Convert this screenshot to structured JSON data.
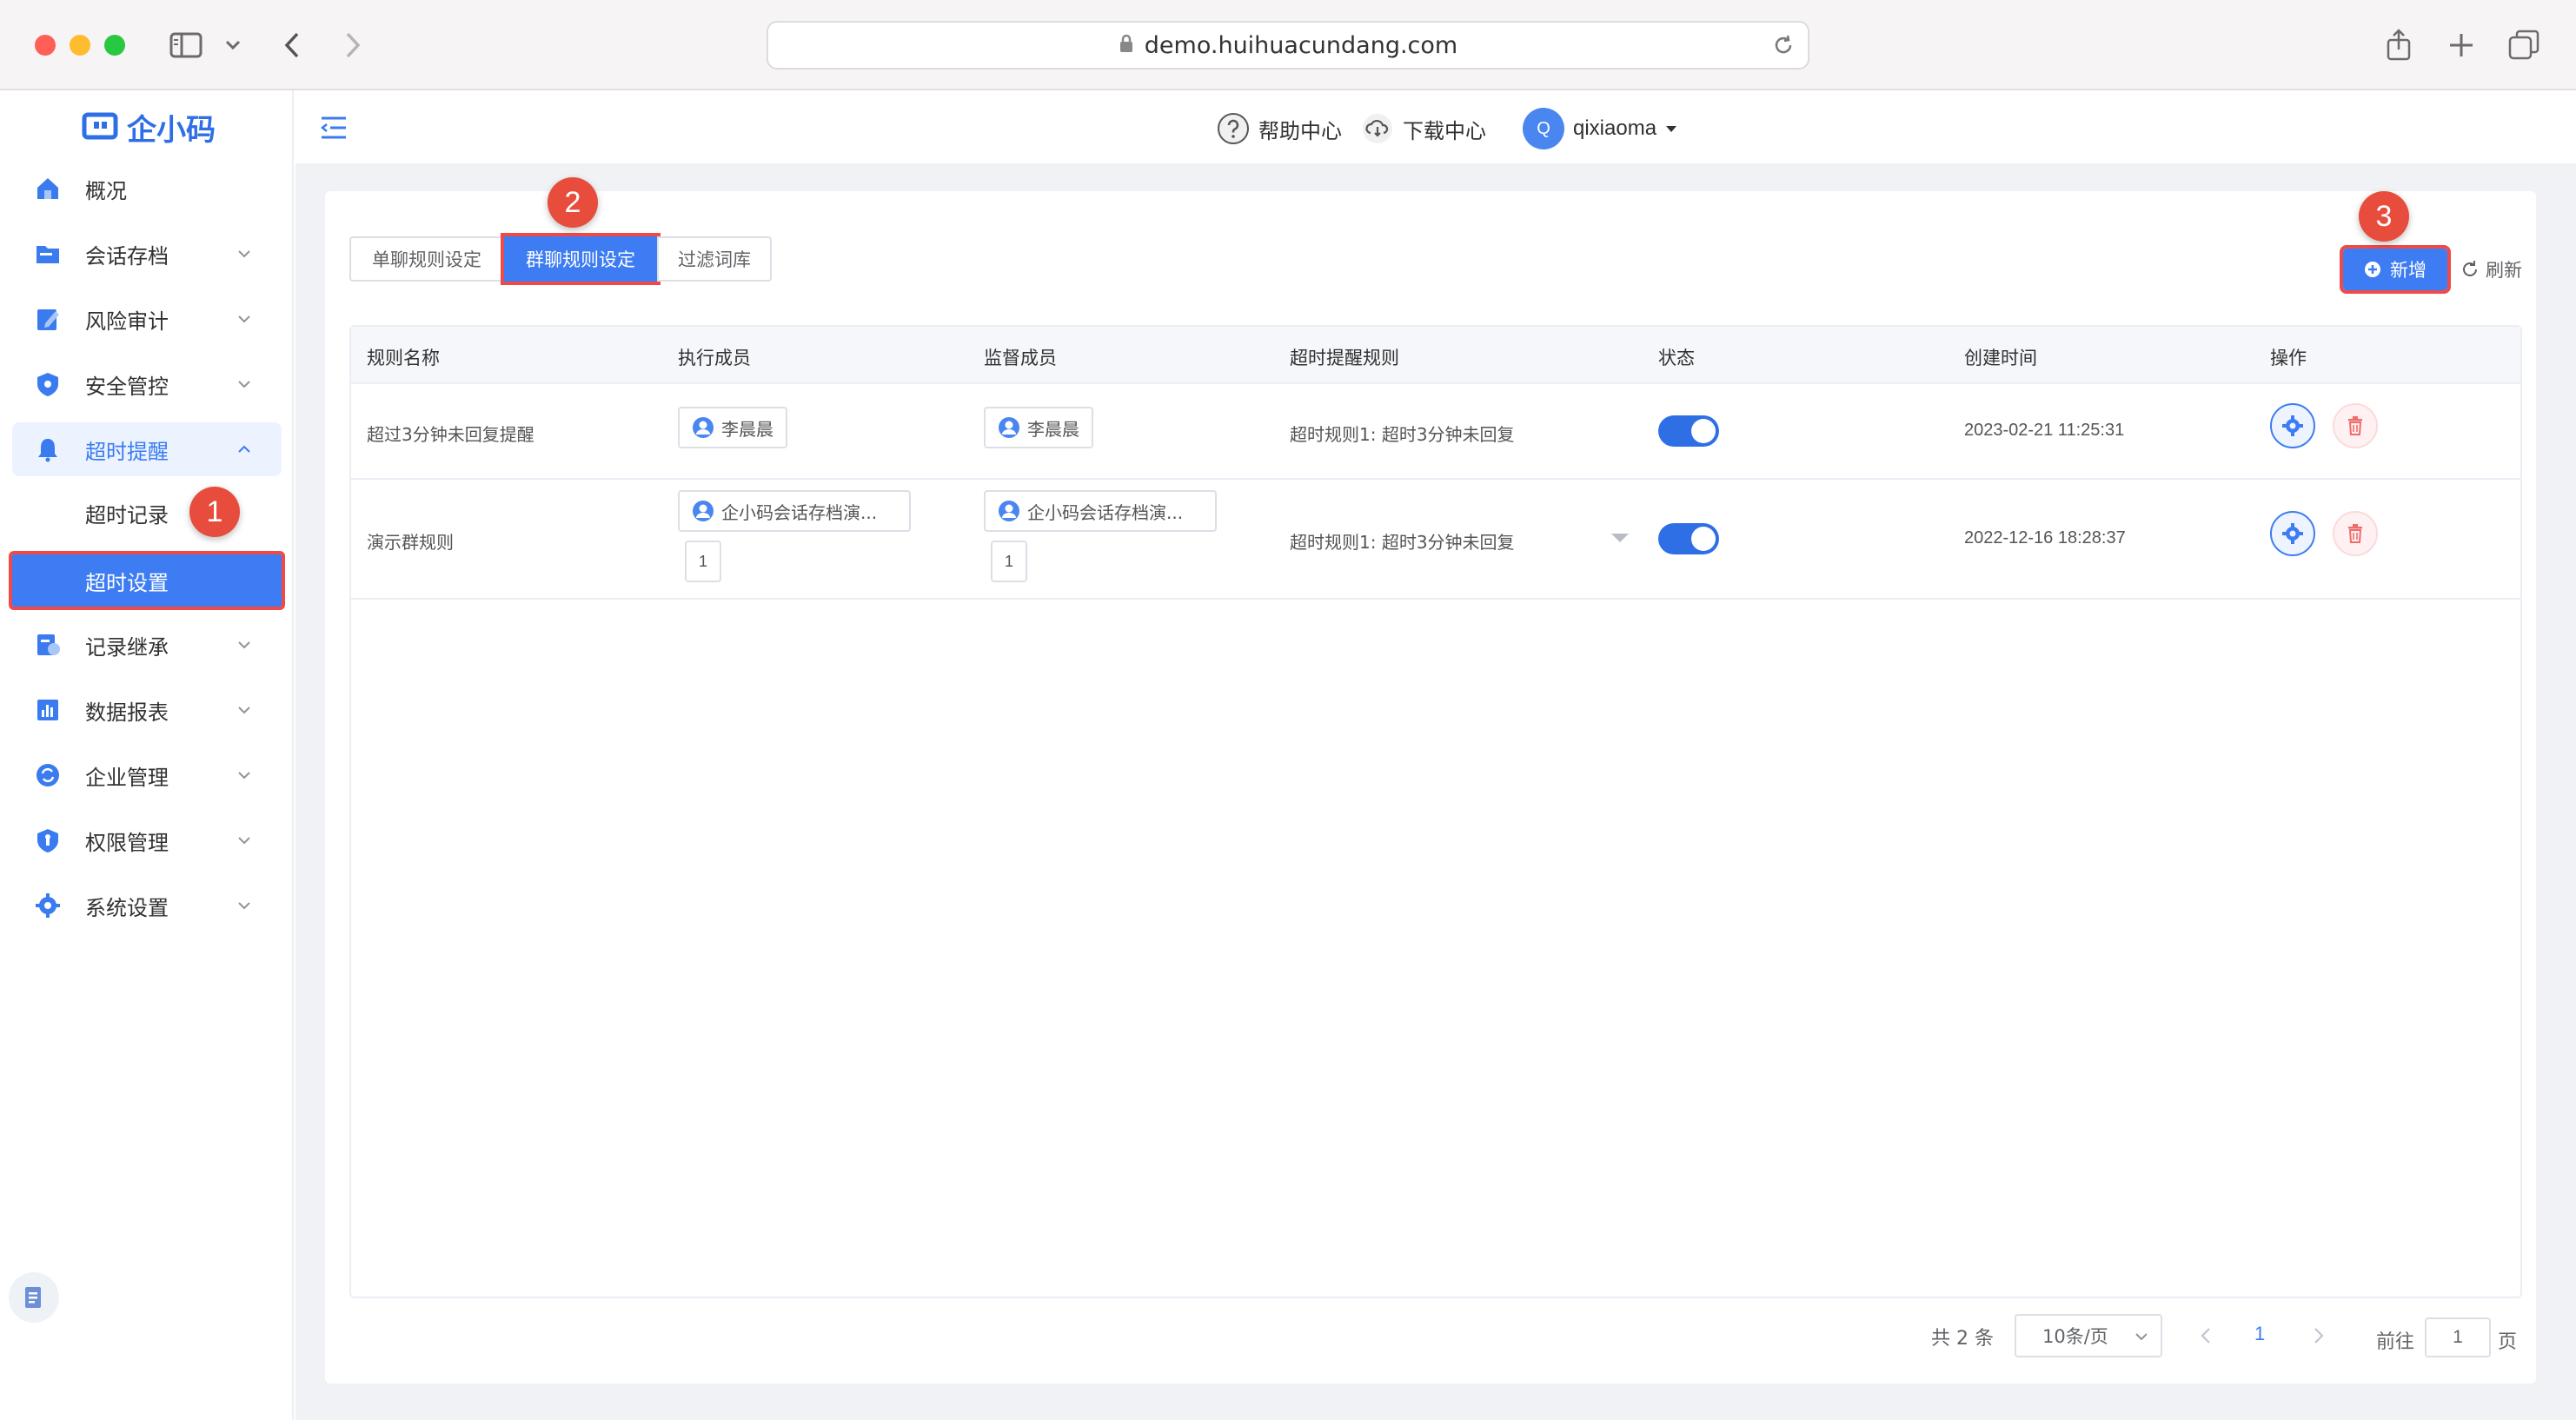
{
  "browser": {
    "url": "demo.huihuacundang.com"
  },
  "logo": {
    "text": "企小码"
  },
  "sidebar": {
    "items": [
      {
        "label": "概况"
      },
      {
        "label": "会话存档"
      },
      {
        "label": "风险审计"
      },
      {
        "label": "安全管控"
      },
      {
        "label": "超时提醒"
      },
      {
        "label": "记录继承"
      },
      {
        "label": "数据报表"
      },
      {
        "label": "企业管理"
      },
      {
        "label": "权限管理"
      },
      {
        "label": "系统设置"
      }
    ],
    "sub_items": [
      {
        "label": "超时记录"
      },
      {
        "label": "超时设置"
      }
    ]
  },
  "header": {
    "help": "帮助中心",
    "download": "下载中心",
    "avatar_letter": "Q",
    "username": "qixiaoma"
  },
  "annotations": [
    "1",
    "2",
    "3"
  ],
  "tabs": [
    {
      "label": "单聊规则设定"
    },
    {
      "label": "群聊规则设定"
    },
    {
      "label": "过滤词库"
    }
  ],
  "actions": {
    "add": "新增",
    "refresh": "刷新"
  },
  "table": {
    "columns": [
      "规则名称",
      "执行成员",
      "监督成员",
      "超时提醒规则",
      "状态",
      "创建时间",
      "操作"
    ],
    "rows": [
      {
        "name": "超过3分钟未回复提醒",
        "executor": "李晨晨",
        "supervisor": "李晨晨",
        "rule": "超时规则1: 超时3分钟未回复",
        "status": true,
        "created": "2023-02-21 11:25:31"
      },
      {
        "name": "演示群规则",
        "executor": "企小码会话存档演...",
        "executor_count": "1",
        "supervisor": "企小码会话存档演...",
        "supervisor_count": "1",
        "rule": "超时规则1: 超时3分钟未回复",
        "status": true,
        "created": "2022-12-16 18:28:37"
      }
    ]
  },
  "pagination": {
    "total": "共 2 条",
    "page_size": "10条/页",
    "current_page": "1",
    "goto_label": "前往",
    "goto_value": "1",
    "page_suffix": "页"
  },
  "colors": {
    "primary": "#3d7cf2",
    "highlight": "#ef4a4a",
    "badge": "#e74c3c"
  }
}
